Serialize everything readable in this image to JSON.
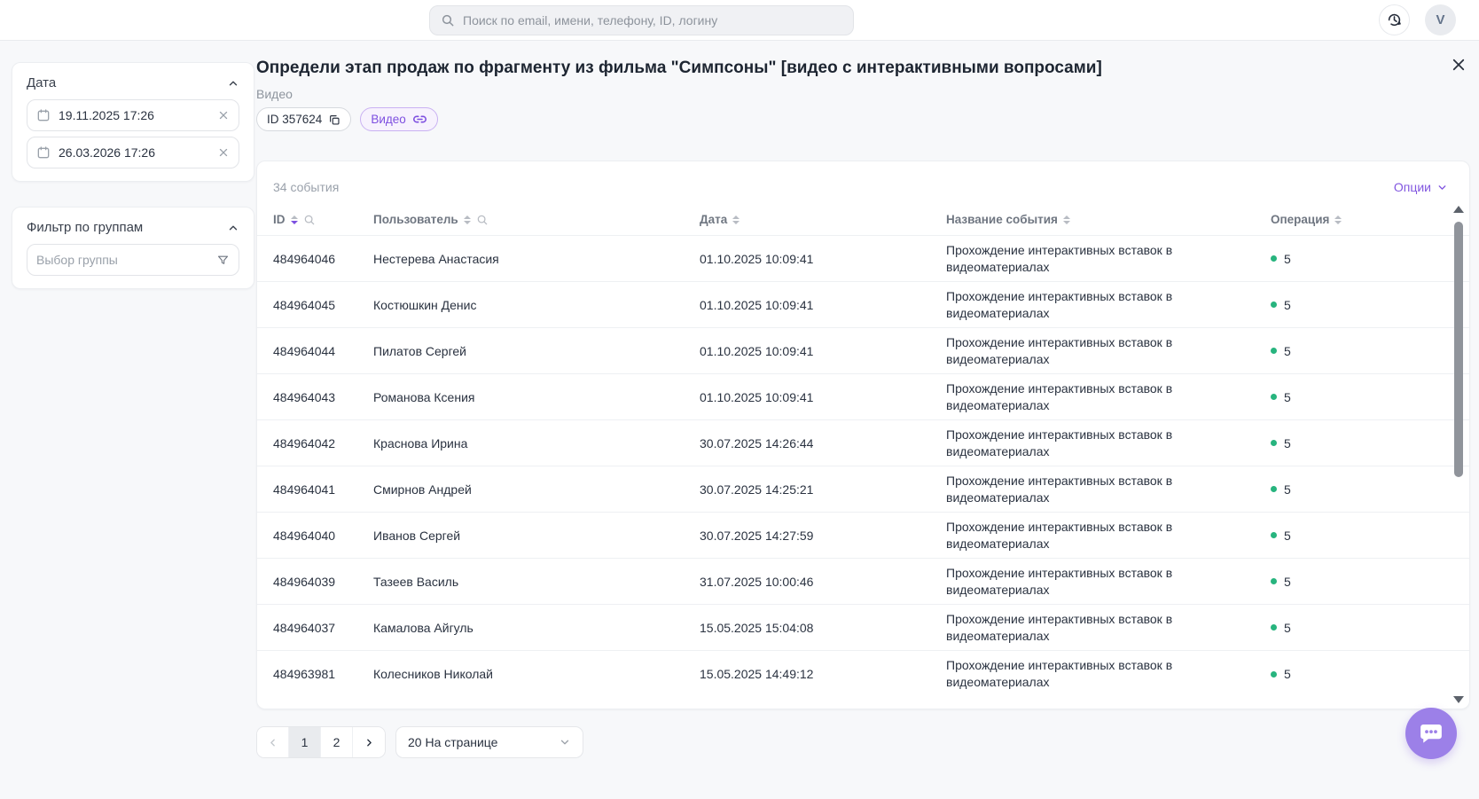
{
  "topbar": {
    "search_placeholder": "Поиск по email, имени, телефону, ID, логину",
    "avatar_letter": "V"
  },
  "sidebar": {
    "date_filter": {
      "title": "Дата",
      "from": "19.11.2025 17:26",
      "to": "26.03.2026 17:26"
    },
    "group_filter": {
      "title": "Фильтр по группам",
      "placeholder": "Выбор группы"
    }
  },
  "content": {
    "title": "Определи этап продаж по фрагменту из фильма \"Симпсоны\" [видео с интерактивными вопросами]",
    "subtitle": "Видео",
    "id_badge": "ID 357624",
    "type_badge": "Видео"
  },
  "table": {
    "count_label": "34 события",
    "options_label": "Опции",
    "columns": [
      "ID",
      "Пользователь",
      "Дата",
      "Название события",
      "Операция"
    ],
    "rows": [
      {
        "id": "484964046",
        "user": "Нестерева Анастасия",
        "date": "01.10.2025 10:09:41",
        "event": "Прохождение интерактивных вставок в видеоматериалах",
        "operation": "5"
      },
      {
        "id": "484964045",
        "user": "Костюшкин Денис",
        "date": "01.10.2025 10:09:41",
        "event": "Прохождение интерактивных вставок в видеоматериалах",
        "operation": "5"
      },
      {
        "id": "484964044",
        "user": "Пилатов Сергей",
        "date": "01.10.2025 10:09:41",
        "event": "Прохождение интерактивных вставок в видеоматериалах",
        "operation": "5"
      },
      {
        "id": "484964043",
        "user": "Романова Ксения",
        "date": "01.10.2025 10:09:41",
        "event": "Прохождение интерактивных вставок в видеоматериалах",
        "operation": "5"
      },
      {
        "id": "484964042",
        "user": "Краснова Ирина",
        "date": "30.07.2025 14:26:44",
        "event": "Прохождение интерактивных вставок в видеоматериалах",
        "operation": "5"
      },
      {
        "id": "484964041",
        "user": "Смирнов Андрей",
        "date": "30.07.2025 14:25:21",
        "event": "Прохождение интерактивных вставок в видеоматериалах",
        "operation": "5"
      },
      {
        "id": "484964040",
        "user": "Иванов Сергей",
        "date": "30.07.2025 14:27:59",
        "event": "Прохождение интерактивных вставок в видеоматериалах",
        "operation": "5"
      },
      {
        "id": "484964039",
        "user": "Тазеев Василь",
        "date": "31.07.2025 10:00:46",
        "event": "Прохождение интерактивных вставок в видеоматериалах",
        "operation": "5"
      },
      {
        "id": "484964037",
        "user": "Камалова Айгуль",
        "date": "15.05.2025 15:04:08",
        "event": "Прохождение интерактивных вставок в видеоматериалах",
        "operation": "5"
      },
      {
        "id": "484963981",
        "user": "Колесников Николай",
        "date": "15.05.2025 14:49:12",
        "event": "Прохождение интерактивных вставок в видеоматериалах",
        "operation": "5"
      }
    ]
  },
  "pagination": {
    "pages": [
      "1",
      "2"
    ],
    "current_page": "1",
    "per_page_label": "20 На странице"
  },
  "icons": {
    "search": "magnifier",
    "history": "clock-rotate",
    "calendar": "calendar",
    "clear": "x",
    "funnel": "filter",
    "copy": "copy",
    "link": "chain-link",
    "sort": "caret-up-down",
    "chat": "speech-bubble"
  },
  "colors": {
    "accent_purple": "#8257e0",
    "badge_purple_border": "#c9b1f2",
    "badge_purple_bg": "#f7f2fd",
    "success_green": "#27b47e",
    "page_bg": "#f7f8fa"
  }
}
